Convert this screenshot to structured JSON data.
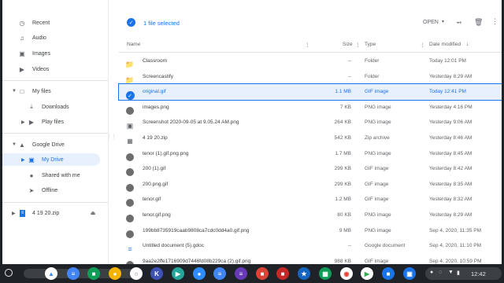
{
  "sidebar": {
    "recent": "Recent",
    "audio": "Audio",
    "images": "Images",
    "videos": "Videos",
    "my_files": "My files",
    "downloads": "Downloads",
    "play_files": "Play files",
    "google_drive": "Google Drive",
    "my_drive": "My Drive",
    "shared_with_me": "Shared with me",
    "offline": "Offline",
    "zip_item": "4 19 20.zip"
  },
  "toolbar": {
    "selection": "1 file selected",
    "open_label": "OPEN"
  },
  "columns": {
    "name": "Name",
    "size": "Size",
    "type": "Type",
    "date": "Date modified"
  },
  "files": [
    {
      "name": "Classroom",
      "size": "--",
      "type": "Folder",
      "date": "Today 12:01 PM",
      "icon": "folder-icon"
    },
    {
      "name": "Screencastify",
      "size": "--",
      "type": "Folder",
      "date": "Yesterday 8:29 AM",
      "icon": "folder-icon"
    },
    {
      "name": "original.gif",
      "size": "1.1 MB",
      "type": "GIF image",
      "date": "Today 12:41 PM",
      "icon": "check-icon"
    },
    {
      "name": "images.png",
      "size": "7 KB",
      "type": "PNG image",
      "date": "Yesterday 4:16 PM",
      "icon": "image-thumb"
    },
    {
      "name": "Screenshot 2020-09-05 at 9.05.24 AM.png",
      "size": "264 KB",
      "type": "PNG image",
      "date": "Yesterday 9:06 AM",
      "icon": "image-icon"
    },
    {
      "name": "4 19 20.zip",
      "size": "542 KB",
      "type": "Zip archive",
      "date": "Yesterday 8:46 AM",
      "icon": "zip-icon"
    },
    {
      "name": "tenor (1).gif.png.png",
      "size": "1.7 MB",
      "type": "PNG image",
      "date": "Yesterday 8:45 AM",
      "icon": "image-thumb"
    },
    {
      "name": "200 (1).gif",
      "size": "299 KB",
      "type": "GIF image",
      "date": "Yesterday 8:42 AM",
      "icon": "image-thumb"
    },
    {
      "name": "200.png.gif",
      "size": "299 KB",
      "type": "GIF image",
      "date": "Yesterday 8:35 AM",
      "icon": "image-thumb"
    },
    {
      "name": "tenor.gif",
      "size": "1.2 MB",
      "type": "GIF image",
      "date": "Yesterday 8:32 AM",
      "icon": "image-thumb"
    },
    {
      "name": "tenor.gif.png",
      "size": "80 KB",
      "type": "PNG image",
      "date": "Yesterday 8:29 AM",
      "icon": "image-thumb"
    },
    {
      "name": "199bb8735919caab9808ca7cdc0dd4a0.gif.png",
      "size": "9 MB",
      "type": "PNG image",
      "date": "Sep 4, 2020, 11:35 PM",
      "icon": "image-thumb"
    },
    {
      "name": "Untitled document (5).gdoc",
      "size": "--",
      "type": "Google document",
      "date": "Sep 4, 2020, 11:10 PM",
      "icon": "doc-icon"
    },
    {
      "name": "9aa2e2ffe1716909d7446fd08b229ca (2).gif.png",
      "size": "988 KB",
      "type": "GIF image",
      "date": "Sep 4, 2020, 10:59 PM",
      "icon": "image-thumb"
    }
  ],
  "tray": {
    "time": "12:42"
  },
  "colors": {
    "accent": "#1a73e8",
    "selected_bg": "#e8f0fe",
    "shelf": "#1f2227"
  }
}
